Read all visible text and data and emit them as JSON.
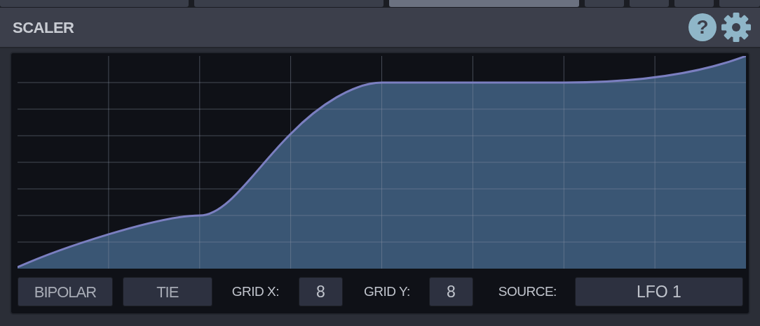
{
  "top_tabs": [
    {
      "selected": false
    },
    {
      "selected": false
    },
    {
      "selected": true
    },
    {
      "selected": false
    },
    {
      "selected": false
    },
    {
      "selected": false
    },
    {
      "selected": false
    }
  ],
  "panel": {
    "title": "SCALER",
    "help_icon": "?"
  },
  "controls": {
    "bipolar": {
      "label": "BIPOLAR",
      "on": false
    },
    "tie": {
      "label": "TIE",
      "on": false
    },
    "grid_x": {
      "label": "GRID X:",
      "value": "8"
    },
    "grid_y": {
      "label": "GRID Y:",
      "value": "8"
    },
    "source": {
      "label": "SOURCE:",
      "value": "LFO 1"
    }
  }
}
